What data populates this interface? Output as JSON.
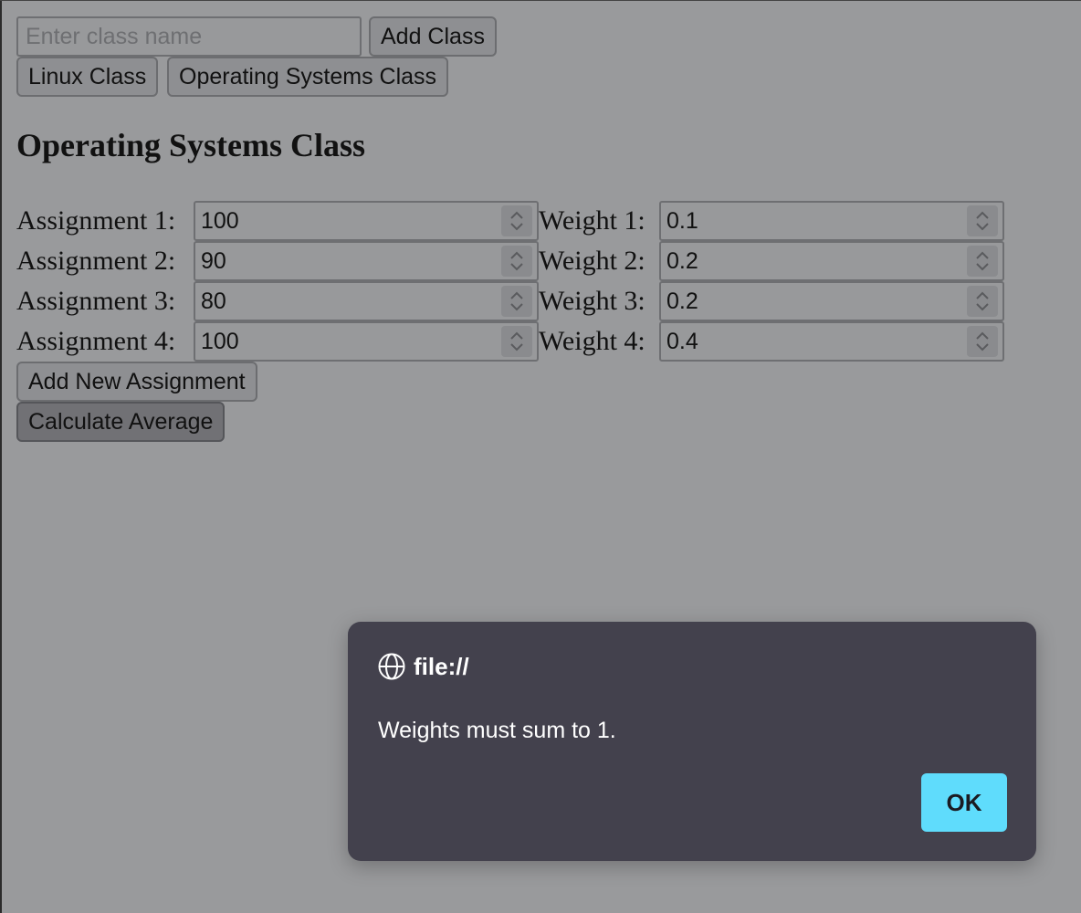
{
  "class_input": {
    "placeholder": "Enter class name"
  },
  "add_class_label": "Add Class",
  "class_tabs": [
    {
      "label": "Linux Class"
    },
    {
      "label": "Operating Systems Class"
    }
  ],
  "heading": "Operating Systems Class",
  "assignments": [
    {
      "label": "Assignment 1:",
      "value": "100",
      "weight_label": "Weight 1:",
      "weight": "0.1"
    },
    {
      "label": "Assignment 2:",
      "value": "90",
      "weight_label": "Weight 2:",
      "weight": "0.2"
    },
    {
      "label": "Assignment 3:",
      "value": "80",
      "weight_label": "Weight 3:",
      "weight": "0.2"
    },
    {
      "label": "Assignment 4:",
      "value": "100",
      "weight_label": "Weight 4:",
      "weight": "0.4"
    }
  ],
  "add_assignment_label": "Add New Assignment",
  "calculate_label": "Calculate Average",
  "dialog": {
    "origin": "file://",
    "message": "Weights must sum to 1.",
    "ok_label": "OK",
    "icon": "globe-icon",
    "ok_color": "#5fdcfc",
    "background_color": "#43414d"
  }
}
